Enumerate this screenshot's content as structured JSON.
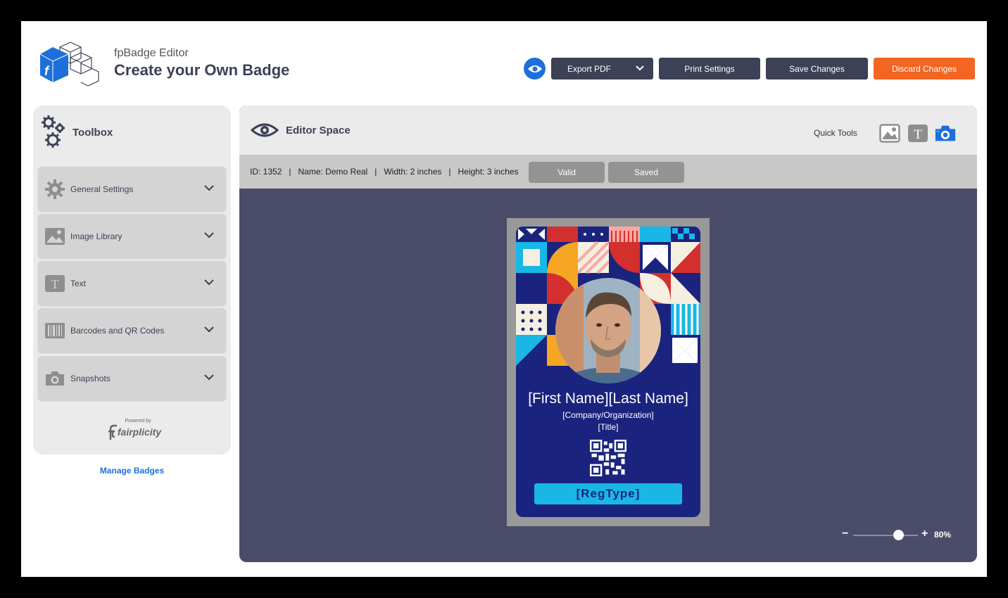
{
  "header": {
    "app_name": "fpBadge Editor",
    "page_title": "Create your Own Badge",
    "preview_icon": "eye-icon",
    "buttons": {
      "export": "Export PDF",
      "print": "Print Settings",
      "save": "Save Changes",
      "discard": "Discard Changes"
    },
    "colors": {
      "primary": "#3d4156",
      "accent": "#1e6fd9",
      "discard": "#f26522"
    }
  },
  "toolbox": {
    "title": "Toolbox",
    "items": [
      {
        "label": "General Settings",
        "icon": "gear-icon"
      },
      {
        "label": "Image Library",
        "icon": "image-icon"
      },
      {
        "label": "Text",
        "icon": "text-icon"
      },
      {
        "label": "Barcodes and QR Codes",
        "icon": "barcode-icon"
      },
      {
        "label": "Snapshots",
        "icon": "camera-icon"
      }
    ],
    "powered_by": "Powered by",
    "brand": "fairplicity",
    "manage_link": "Manage Badges"
  },
  "editor": {
    "title": "Editor Space",
    "quick_tools_label": "Quick Tools",
    "info": {
      "id": "ID: 1352",
      "name": "Name: Demo Real",
      "width": "Width: 2 inches",
      "height": "Height: 3 inches"
    },
    "status": {
      "valid": "Valid",
      "saved": "Saved"
    },
    "badge": {
      "name": "[First Name][Last Name]",
      "company": "[Company/Organization]",
      "title": "[Title]",
      "reg_type": "[RegType]"
    },
    "zoom": {
      "minus": "−",
      "plus": "+",
      "value": "80%",
      "level_fraction": 0.7
    }
  }
}
